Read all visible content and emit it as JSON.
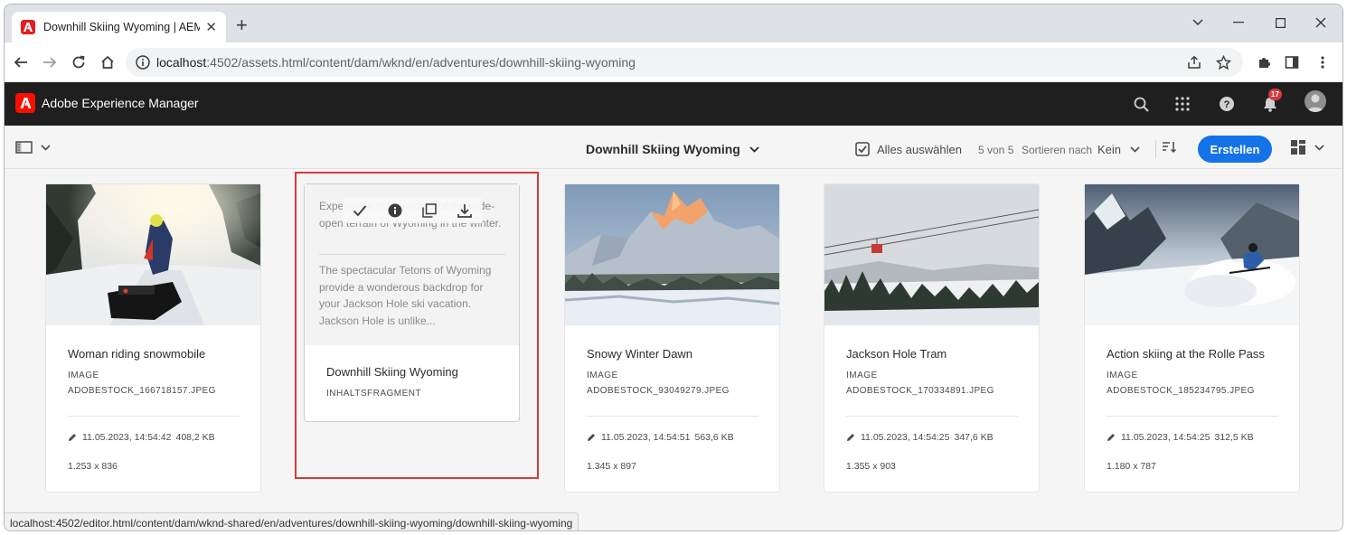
{
  "browser": {
    "tab_title": "Downhill Skiing Wyoming | AEM",
    "url_host": "localhost",
    "url_rest": ":4502/assets.html/content/dam/wknd/en/adventures/downhill-skiing-wyoming",
    "new_tab": "+"
  },
  "shell": {
    "title": "Adobe Experience Manager",
    "notification_count": "17"
  },
  "actionbar": {
    "page_title": "Downhill Skiing Wyoming",
    "select_all": "Alles auswählen",
    "count": "5 von 5",
    "sort_label": "Sortieren nach",
    "sort_value": "Kein",
    "create": "Erstellen"
  },
  "cards": [
    {
      "title": "Woman riding snowmobile",
      "type": "Image",
      "file": "ADOBESTOCK_166718157.JPEG",
      "modified": "11.05.2023, 14:54:42",
      "size": "408,2 KB",
      "dimensions": "1.253 x 836"
    },
    {
      "title": "Snowy Winter Dawn",
      "type": "Image",
      "file": "ADOBESTOCK_93049279.JPEG",
      "modified": "11.05.2023, 14:54:51",
      "size": "563,6 KB",
      "dimensions": "1.345 x 897"
    },
    {
      "title": "Jackson Hole Tram",
      "type": "Image",
      "file": "ADOBESTOCK_170334891.JPEG",
      "modified": "11.05.2023, 14:54:25",
      "size": "347,6 KB",
      "dimensions": "1.355 x 903"
    },
    {
      "title": "Action skiing at the Rolle Pass",
      "type": "Image",
      "file": "ADOBESTOCK_185234795.JPEG",
      "modified": "11.05.2023, 14:54:25",
      "size": "312,5 KB",
      "dimensions": "1.180 x 787"
    }
  ],
  "fragment": {
    "preview_1": "Experience the wonders of the wide-open terrain of Wyoming in the winter.",
    "preview_2": "The spectacular Tetons of Wyoming provide a wonderous backdrop for your Jackson Hole ski vacation. Jackson Hole is unlike...",
    "title": "Downhill Skiing Wyoming",
    "type": "Inhaltsfragment"
  },
  "status_url": "localhost:4502/editor.html/content/dam/wknd-shared/en/adventures/downhill-skiing-wyoming/downhill-skiing-wyoming",
  "colors": {
    "accent": "#1473e6",
    "highlight": "#d9393c",
    "shell": "#1f1f1f",
    "adobe_red": "#fa0f00"
  }
}
